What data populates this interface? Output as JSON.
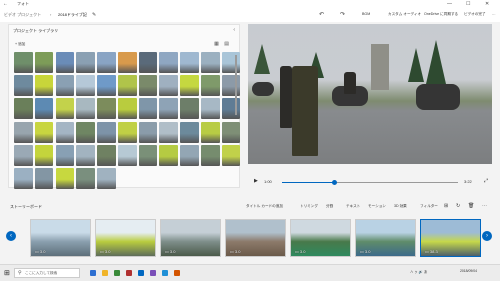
{
  "title_bar": {
    "app_title": "フォト",
    "back_glyph": "←",
    "minimize": "—",
    "maximize": "☐",
    "close": "✕"
  },
  "toolbar": {
    "breadcrumb_root": "ビデオ プロジェクト",
    "breadcrumb_separator": "›",
    "project_name": "2018ドライブ記",
    "edit_glyph": "✎",
    "undo": "↶",
    "redo": "↷",
    "bgm_label": "BGM",
    "custom_audio_label": "カスタム オーディオ",
    "onedrive_label": "OneDrive に同期する",
    "export_label": "ビデオの完了",
    "more_glyph": "…"
  },
  "library": {
    "heading": "プロジェクト ライブラリ",
    "collapse_glyph": "‹",
    "add_label": "+ 追加",
    "view_grid_glyph": "▦",
    "view_list_glyph": "▤",
    "thumb_colors": [
      "#6f8f6a",
      "#7d9c58",
      "#6a8cb8",
      "#8aa0b3",
      "#89a4c4",
      "#d89a4c",
      "#5a6a7a",
      "#8fa7c2",
      "#9fb8d0",
      "#9bb0c0",
      "#a9c5d8",
      "#6e8a9e",
      "#c8d53a",
      "#8aa0b3",
      "#b5c8d8",
      "#6f9ac8",
      "#b0c44a",
      "#7a8a6a",
      "#9fb0c0",
      "#c5d840",
      "#7f9a6a",
      "#8c9aa8",
      "#6a7f5a",
      "#5d8ab3",
      "#c3d24b",
      "#a8b8c0",
      "#7c8c5c",
      "#b9cc3e",
      "#7f96a9",
      "#8ea3b6",
      "#6d7e69",
      "#a7b8c5",
      "#5f7c95",
      "#98a5ae",
      "#c8d540",
      "#a4b5c4",
      "#6f8663",
      "#7d93a8",
      "#c0d045",
      "#8a9caa",
      "#b0bec8",
      "#6c8a9c",
      "#b8cc44",
      "#7e8f76",
      "#9aa9b5",
      "#c4d43c",
      "#88a0b4",
      "#a2b3c0",
      "#6f8162",
      "#b6c9d4",
      "#7a9078",
      "#b5cb42",
      "#93a6b4",
      "#768c6e",
      "#c1d14a",
      "#9bb0c2",
      "#8396a4",
      "#c7d83f",
      "#7a8f7e",
      "#a0b2c0"
    ]
  },
  "player": {
    "play_glyph": "▶",
    "current_time": "1:00",
    "total_time": "3:22",
    "progress": 0.3,
    "fullscreen_glyph": "⤢"
  },
  "storyboard": {
    "title": "ストーリーボード",
    "add_title_card": "タイトル カードの追加",
    "trim": "トリミング",
    "split": "分割",
    "text": "テキスト",
    "motion": "モーション",
    "effects_3d": "3D 効果",
    "filters": "フィルター",
    "clips": [
      {
        "duration": "3.0",
        "colors": [
          "#c9dbe8",
          "#8a9fae",
          "#5d6f7a"
        ]
      },
      {
        "duration": "3.0",
        "colors": [
          "#e5edf2",
          "#b9cc3e",
          "#5e6d5a"
        ]
      },
      {
        "duration": "3.0",
        "colors": [
          "#c5cfd6",
          "#7e8e8a",
          "#4b5a4a"
        ]
      },
      {
        "duration": "3.0",
        "colors": [
          "#b0c0cc",
          "#8c7a6a",
          "#6b5a4a"
        ]
      },
      {
        "duration": "3.0",
        "colors": [
          "#cfd9e0",
          "#48794a",
          "#2f8a5f"
        ]
      },
      {
        "duration": "3.0",
        "colors": [
          "#b9d2e4",
          "#5f8c6a",
          "#3c6a8a"
        ]
      },
      {
        "duration": "38.3",
        "colors": [
          "#9dbbd6",
          "#c6d84a",
          "#4e5f6a"
        ]
      }
    ]
  },
  "taskbar": {
    "start_glyph": "⊞",
    "search_glyph": "⚲",
    "search_placeholder": "ここに入力して検索",
    "app_colors": [
      "#2e6fd1",
      "#f0b429",
      "#3a8a3a",
      "#b03030",
      "#0067c0",
      "#7a4fb8",
      "#1f8fd6",
      "#d35400"
    ],
    "tray_text": "∧ ㇰ 🔊 あ",
    "clock": "2018/09/04"
  }
}
